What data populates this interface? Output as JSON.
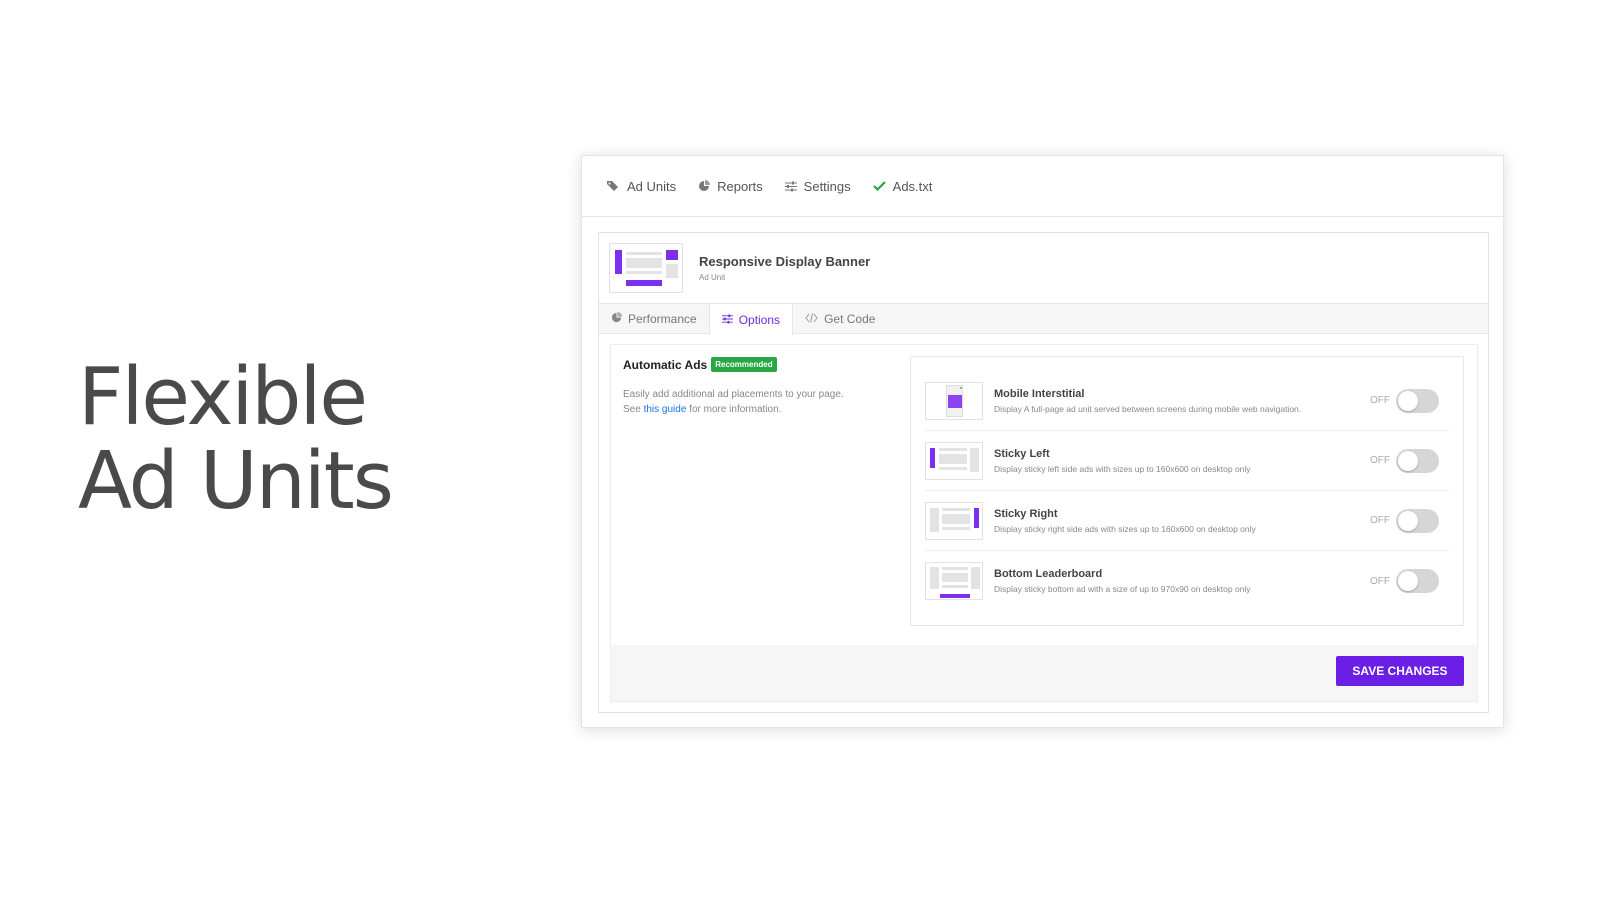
{
  "hero": {
    "line1": "Flexible",
    "line2": "Ad Units"
  },
  "nav": {
    "items": [
      {
        "label": "Ad Units",
        "icon": "tags-icon"
      },
      {
        "label": "Reports",
        "icon": "pie-chart-icon"
      },
      {
        "label": "Settings",
        "icon": "sliders-icon"
      },
      {
        "label": "Ads.txt",
        "icon": "check-icon"
      }
    ]
  },
  "unit": {
    "name": "Responsive Display Banner",
    "type": "Ad Unit"
  },
  "tabs": [
    {
      "label": "Performance",
      "icon": "pie-chart-icon"
    },
    {
      "label": "Options",
      "icon": "sliders-icon",
      "active": true
    },
    {
      "label": "Get Code",
      "icon": "code-icon"
    }
  ],
  "auto_ads": {
    "title": "Automatic Ads",
    "badge": "Recommended",
    "desc_line1": "Easily add additional ad placements to your page.",
    "desc_see": "See",
    "desc_link": "this guide",
    "desc_rest": "for more information."
  },
  "options": [
    {
      "name": "Mobile Interstitial",
      "desc": "Display A full-page ad unit served between screens during mobile web navigation.",
      "state": "OFF"
    },
    {
      "name": "Sticky Left",
      "desc": "Display sticky left side ads with sizes up to 160x600 on desktop only",
      "state": "OFF"
    },
    {
      "name": "Sticky Right",
      "desc": "Display sticky right side ads with sizes up to 160x600 on desktop only",
      "state": "OFF"
    },
    {
      "name": "Bottom Leaderboard",
      "desc": "Display sticky bottom ad with a size of up to 970x90 on desktop only",
      "state": "OFF"
    }
  ],
  "save_label": "SAVE CHANGES",
  "colors": {
    "accent": "#6a1ee6",
    "badge": "#28a745",
    "link": "#1a73e8",
    "check": "#28a745"
  }
}
